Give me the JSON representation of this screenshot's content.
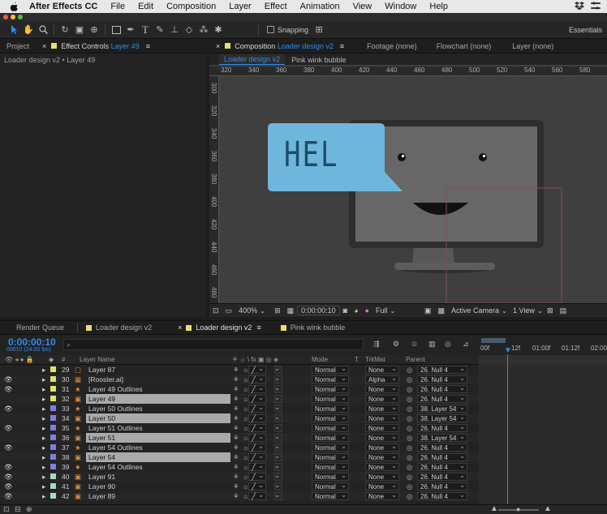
{
  "menubar": {
    "app": "After Effects CC",
    "items": [
      "File",
      "Edit",
      "Composition",
      "Layer",
      "Effect",
      "Animation",
      "View",
      "Window",
      "Help"
    ]
  },
  "toolbar": {
    "snapping_label": "Snapping",
    "workspace": "Essentials",
    "tools": [
      "selection-tool-icon",
      "hand-tool-icon",
      "zoom-tool-icon",
      "rotate-tool-icon",
      "camera-tool-icon",
      "pan-behind-tool-icon",
      "rectangle-tool-icon",
      "pen-tool-icon",
      "type-tool-icon",
      "brush-tool-icon",
      "clone-stamp-tool-icon",
      "eraser-tool-icon",
      "roto-brush-tool-icon",
      "puppet-pin-tool-icon"
    ]
  },
  "left_panel": {
    "tab_project": "Project",
    "tab_effects_prefix": "Effect Controls",
    "tab_effects_layer": "Layer 49",
    "breadcrumb": "Loader design v2 • Layer 49"
  },
  "comp_panel": {
    "tab_prefix": "Composition",
    "tab_comp": "Loader design v2",
    "tab_footage": "Footage (none)",
    "tab_flowchart": "Flowchart (none)",
    "tab_layer": "Layer (none)",
    "subtab_active": "Loader design v2",
    "subtab_other": "Pink wink bubble",
    "ruler_h": [
      "320",
      "340",
      "360",
      "380",
      "400",
      "420",
      "440",
      "460",
      "480",
      "500",
      "520",
      "540",
      "560",
      "580"
    ],
    "ruler_v": [
      "300",
      "320",
      "340",
      "360",
      "380",
      "400",
      "420",
      "440",
      "460",
      "480"
    ],
    "bubble_text": "HEL",
    "footer": {
      "zoom": "400%",
      "timecode": "0:00:00:10",
      "resolution": "Full",
      "camera": "Active Camera",
      "views": "1 View"
    }
  },
  "timeline": {
    "tabs": [
      "Render Queue",
      "Loader design v2",
      "Loader design v2",
      "Pink wink bubble"
    ],
    "timecode": "0:00:00:10",
    "timecode_sub": "00010 (24.00 fps)",
    "search_placeholder": "",
    "columns": {
      "num": "#",
      "layer_name": "Layer Name",
      "mode": "Mode",
      "t": "T",
      "trkmat": "TrkMat",
      "parent": "Parent"
    },
    "ruler": [
      "00f",
      "12f",
      "01:00f",
      "01:12f",
      "02:00"
    ],
    "layers": [
      {
        "num": "29",
        "name": "Layer 87",
        "color": "#e4e170",
        "type": "solid",
        "mode": "Normal",
        "trkmat": "None",
        "parent": "26. Null 4",
        "eye": false,
        "sel": false
      },
      {
        "num": "30",
        "name": "[Rooster.ai]",
        "color": "#e4e170",
        "type": "footage",
        "mode": "Normal",
        "trkmat": "Alpha",
        "parent": "26. Null 4",
        "eye": true,
        "sel": false
      },
      {
        "num": "31",
        "name": "Layer 49 Outlines",
        "color": "#e4e170",
        "type": "shape",
        "mode": "Normal",
        "trkmat": "None",
        "parent": "26. Null 4",
        "eye": true,
        "sel": false
      },
      {
        "num": "32",
        "name": "Layer 49",
        "color": "#e4e170",
        "type": "ai",
        "mode": "Normal",
        "trkmat": "None",
        "parent": "26. Null 4",
        "eye": false,
        "sel": true
      },
      {
        "num": "33",
        "name": "Layer 50 Outlines",
        "color": "#7b7fe0",
        "type": "shape",
        "mode": "Normal",
        "trkmat": "None",
        "parent": "38. Layer 54",
        "eye": true,
        "sel": false
      },
      {
        "num": "34",
        "name": "Layer 50",
        "color": "#7b7fe0",
        "type": "ai",
        "mode": "Normal",
        "trkmat": "None",
        "parent": "38. Layer 54",
        "eye": false,
        "sel": true
      },
      {
        "num": "35",
        "name": "Layer 51 Outlines",
        "color": "#7b7fe0",
        "type": "shape",
        "mode": "Normal",
        "trkmat": "None",
        "parent": "26. Null 4",
        "eye": true,
        "sel": false
      },
      {
        "num": "36",
        "name": "Layer 51",
        "color": "#7b7fe0",
        "type": "ai",
        "mode": "Normal",
        "trkmat": "None",
        "parent": "38. Layer 54",
        "eye": false,
        "sel": true
      },
      {
        "num": "37",
        "name": "Layer 54 Outlines",
        "color": "#7b7fe0",
        "type": "shape",
        "mode": "Normal",
        "trkmat": "None",
        "parent": "26. Null 4",
        "eye": true,
        "sel": false
      },
      {
        "num": "38",
        "name": "Layer 54",
        "color": "#7b7fe0",
        "type": "ai",
        "mode": "Normal",
        "trkmat": "None",
        "parent": "26. Null 4",
        "eye": false,
        "sel": true
      },
      {
        "num": "39",
        "name": "Layer 54 Outlines",
        "color": "#7b7fe0",
        "type": "shape",
        "mode": "Normal",
        "trkmat": "None",
        "parent": "26. Null 4",
        "eye": true,
        "sel": false
      },
      {
        "num": "40",
        "name": "Layer 91",
        "color": "#a8d8c8",
        "type": "ai",
        "mode": "Normal",
        "trkmat": "None",
        "parent": "26. Null 4",
        "eye": true,
        "sel": false
      },
      {
        "num": "41",
        "name": "Layer 90",
        "color": "#a8d8c8",
        "type": "ai",
        "mode": "Normal",
        "trkmat": "None",
        "parent": "26. Null 4",
        "eye": true,
        "sel": false
      },
      {
        "num": "42",
        "name": "Layer 89",
        "color": "#a8d8c8",
        "type": "ai",
        "mode": "Normal",
        "trkmat": "None",
        "parent": "26. Null 4",
        "eye": true,
        "sel": false
      }
    ]
  },
  "colors": {
    "accent": "#2d8ceb",
    "bubble": "#6fb6dc",
    "monitor_frame": "#2e2e2e",
    "monitor_screen": "#676767",
    "viewer_bg": "#3f3f3f"
  }
}
